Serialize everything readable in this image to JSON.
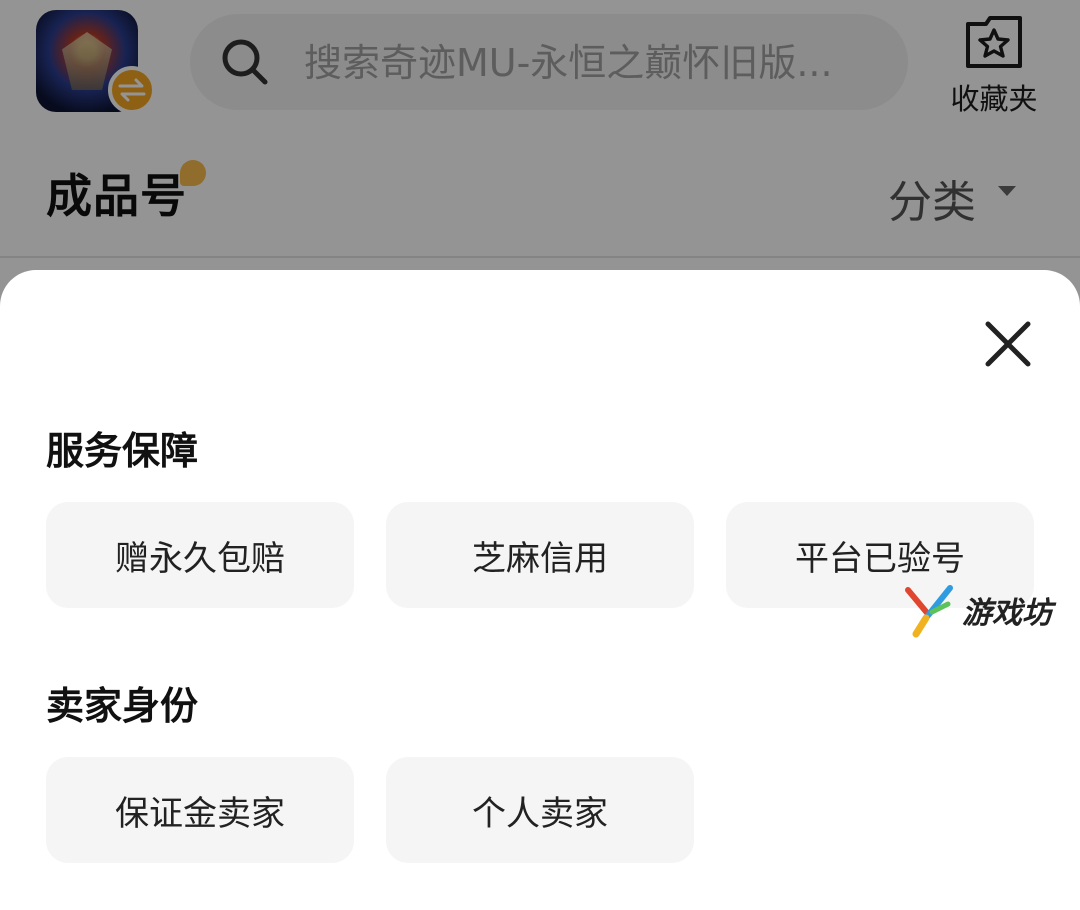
{
  "header": {
    "app_icon": "game-app-icon",
    "swap_icon": "swap-icon",
    "search": {
      "placeholder": "搜索奇迹MU-永恒之巅怀旧版...",
      "icon": "search-icon"
    },
    "favorites": {
      "label": "收藏夹",
      "icon": "star-folder-icon"
    }
  },
  "page": {
    "title": "成品号",
    "category_label": "分类"
  },
  "filter_sheet": {
    "close_icon": "close-icon",
    "sections": [
      {
        "title": "服务保障",
        "options": [
          "赠永久包赔",
          "芝麻信用",
          "平台已验号"
        ]
      },
      {
        "title": "卖家身份",
        "options": [
          "保证金卖家",
          "个人卖家"
        ]
      }
    ]
  },
  "watermark": {
    "text": "游戏坊"
  },
  "colors": {
    "accent_orange": "#f5a623",
    "chip_bg": "#f5f5f5",
    "overlay": "rgba(0,0,0,0.42)"
  }
}
